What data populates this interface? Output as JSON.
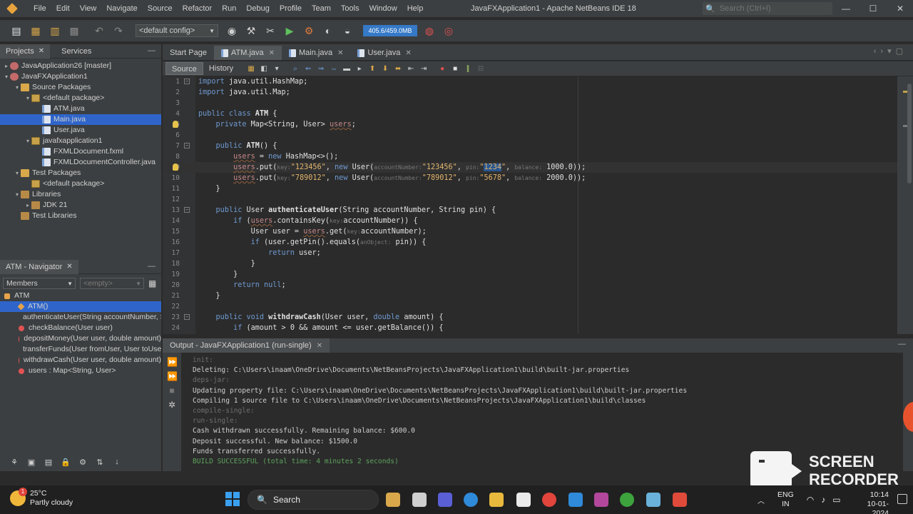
{
  "window": {
    "title": "JavaFXApplication1 - Apache NetBeans IDE 18",
    "search_placeholder": "Search (Ctrl+I)",
    "controls": [
      "—",
      "☐",
      "✕"
    ]
  },
  "menu": [
    "File",
    "Edit",
    "View",
    "Navigate",
    "Source",
    "Refactor",
    "Run",
    "Debug",
    "Profile",
    "Team",
    "Tools",
    "Window",
    "Help"
  ],
  "toolbar": {
    "config": "<default config>",
    "memory": "405.6/459.0MB"
  },
  "projects_panel": {
    "tabs": [
      "Projects",
      "Services"
    ],
    "tree": [
      {
        "label": "JavaApplication26 [master]",
        "indent": 0,
        "twist": "▸",
        "icon": "project"
      },
      {
        "label": "JavaFXApplication1",
        "indent": 0,
        "twist": "▾",
        "icon": "project"
      },
      {
        "label": "Source Packages",
        "indent": 1,
        "twist": "▾",
        "icon": "folder"
      },
      {
        "label": "<default package>",
        "indent": 2,
        "twist": "▾",
        "icon": "package"
      },
      {
        "label": "ATM.java",
        "indent": 3,
        "twist": "",
        "icon": "java"
      },
      {
        "label": "Main.java",
        "indent": 3,
        "twist": "",
        "icon": "java",
        "selected": true
      },
      {
        "label": "User.java",
        "indent": 3,
        "twist": "",
        "icon": "java"
      },
      {
        "label": "javafxapplication1",
        "indent": 2,
        "twist": "▾",
        "icon": "package"
      },
      {
        "label": "FXMLDocument.fxml",
        "indent": 3,
        "twist": "",
        "icon": "java"
      },
      {
        "label": "FXMLDocumentController.java",
        "indent": 3,
        "twist": "",
        "icon": "java"
      },
      {
        "label": "Test Packages",
        "indent": 1,
        "twist": "▾",
        "icon": "folder"
      },
      {
        "label": "<default package>",
        "indent": 2,
        "twist": "",
        "icon": "package"
      },
      {
        "label": "Libraries",
        "indent": 1,
        "twist": "▾",
        "icon": "library"
      },
      {
        "label": "JDK 21",
        "indent": 2,
        "twist": "▸",
        "icon": "library"
      },
      {
        "label": "Test Libraries",
        "indent": 1,
        "twist": "",
        "icon": "library"
      }
    ]
  },
  "navigator": {
    "title": "ATM - Navigator",
    "filter_select": "Members",
    "filter_empty": "<empty>",
    "root": "ATM",
    "members": [
      {
        "label": "ATM()",
        "kind": "constructor",
        "selected": true
      },
      {
        "label": "authenticateUser(String accountNumber, S",
        "kind": "method"
      },
      {
        "label": "checkBalance(User user)",
        "kind": "method"
      },
      {
        "label": "depositMoney(User user, double amount)",
        "kind": "method"
      },
      {
        "label": "transferFunds(User fromUser, User toUser, d",
        "kind": "method"
      },
      {
        "label": "withdrawCash(User user, double amount)",
        "kind": "method"
      },
      {
        "label": "users : Map<String, User>",
        "kind": "field"
      }
    ]
  },
  "editor": {
    "tabs": [
      "Start Page",
      "ATM.java",
      "Main.java",
      "User.java"
    ],
    "active_tab": "ATM.java",
    "view_modes": [
      "Source",
      "History"
    ],
    "active_line": 9
  },
  "output": {
    "tab": "Output - JavaFXApplication1 (run-single)",
    "lines": [
      {
        "text": "init:",
        "style": "dim"
      },
      {
        "text": "Deleting: C:\\Users\\inaam\\OneDrive\\Documents\\NetBeansProjects\\JavaFXApplication1\\build\\built-jar.properties",
        "style": "normal"
      },
      {
        "text": "deps-jar:",
        "style": "dim"
      },
      {
        "text": "Updating property file: C:\\Users\\inaam\\OneDrive\\Documents\\NetBeansProjects\\JavaFXApplication1\\build\\built-jar.properties",
        "style": "normal"
      },
      {
        "text": "Compiling 1 source file to C:\\Users\\inaam\\OneDrive\\Documents\\NetBeansProjects\\JavaFXApplication1\\build\\classes",
        "style": "normal"
      },
      {
        "text": "compile-single:",
        "style": "dim"
      },
      {
        "text": "run-single:",
        "style": "dim"
      },
      {
        "text": "Cash withdrawn successfully. Remaining balance: $600.0",
        "style": "normal"
      },
      {
        "text": "Deposit successful. New balance: $1500.0",
        "style": "normal"
      },
      {
        "text": "Funds transferred successfully.",
        "style": "normal"
      },
      {
        "text": "BUILD SUCCESSFUL (total time: 4 minutes 2 seconds)",
        "style": "green"
      }
    ]
  },
  "recorder": {
    "line1": "SCREEN",
    "line2": "RECORDER"
  },
  "taskbar": {
    "weather_temp": "25°C",
    "weather_desc": "Partly cloudy",
    "weather_badge": "1",
    "search_label": "Search",
    "lang_line1": "ENG",
    "lang_line2": "IN",
    "time": "10:14",
    "date": "10-01-2024"
  },
  "colors": {
    "selection": "#2f65ca",
    "keyword": "#6f9ad1",
    "string": "#e3b56e",
    "memory_bar": "#3579c7",
    "build_success": "#5ea35e"
  }
}
